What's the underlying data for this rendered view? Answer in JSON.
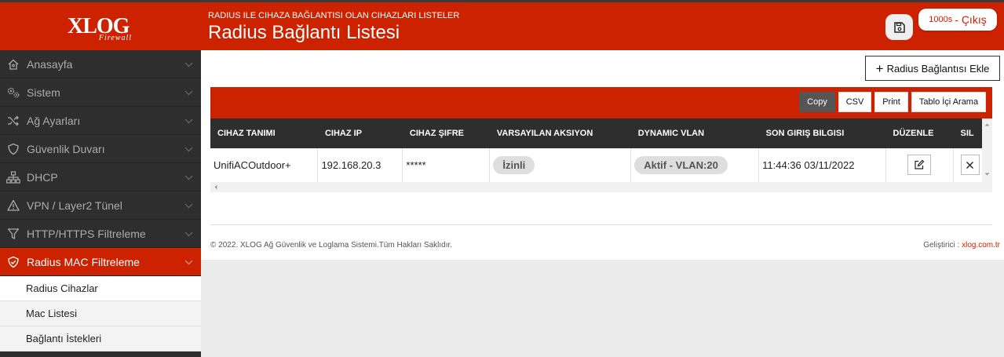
{
  "brand": {
    "logo_text": "XLOG",
    "logo_sub": "Firewall"
  },
  "header": {
    "subtitle": "RADIUS ILE CIHAZA BAĞLANTISI OLAN CIHAZLARI LISTELER",
    "title": "Radius Bağlantı Listesi",
    "counter": "1000s",
    "logout_label": "- Çıkış"
  },
  "sidebar": {
    "items": [
      {
        "label": "Anasayfa",
        "icon": "home-icon"
      },
      {
        "label": "Sistem",
        "icon": "gears-icon"
      },
      {
        "label": "Ağ Ayarları",
        "icon": "shuffle-icon"
      },
      {
        "label": "Güvenlik Duvarı",
        "icon": "shield-icon"
      },
      {
        "label": "DHCP",
        "icon": "network-icon"
      },
      {
        "label": "VPN / Layer2 Tünel",
        "icon": "warning-icon"
      },
      {
        "label": "HTTP/HTTPS Filtreleme",
        "icon": "filter-icon"
      },
      {
        "label": "Radius MAC Filtreleme",
        "icon": "shield-check-icon",
        "active": true
      }
    ],
    "subitems": [
      {
        "label": "Radius Cihazlar",
        "current": true
      },
      {
        "label": "Mac Listesi"
      },
      {
        "label": "Bağlantı İstekleri"
      }
    ]
  },
  "main": {
    "add_button_label": "Radius Bağlantısı Ekle",
    "toolbar": {
      "copy": "Copy",
      "csv": "CSV",
      "print": "Print",
      "search": "Tablo İçi Arama"
    },
    "columns": [
      "CIHAZ TANIMI",
      "CIHAZ IP",
      "CIHAZ ŞIFRE",
      "VARSAYILAN AKSIYON",
      "DYNAMIC VLAN",
      "SON GIRIŞ BILGISI",
      "DÜZENLE",
      "SIL"
    ],
    "rows": [
      {
        "name": "UnifiACOutdoor+",
        "ip": "192.168.20.3",
        "password": "*****",
        "action": "İzinli",
        "vlan": "Aktif - VLAN:20",
        "last_login": "11:44:36 03/11/2022"
      }
    ]
  },
  "footer": {
    "copyright": "© 2022. XLOG Ağ Güvenlik ve Loglama Sistemi.Tüm Hakları Saklıdır.",
    "dev_label": "Geliştirici :",
    "dev_link": "xlog.com.tr"
  },
  "colors": {
    "brand_red": "#cc2200",
    "sidebar_dark": "#2e2e2e"
  }
}
